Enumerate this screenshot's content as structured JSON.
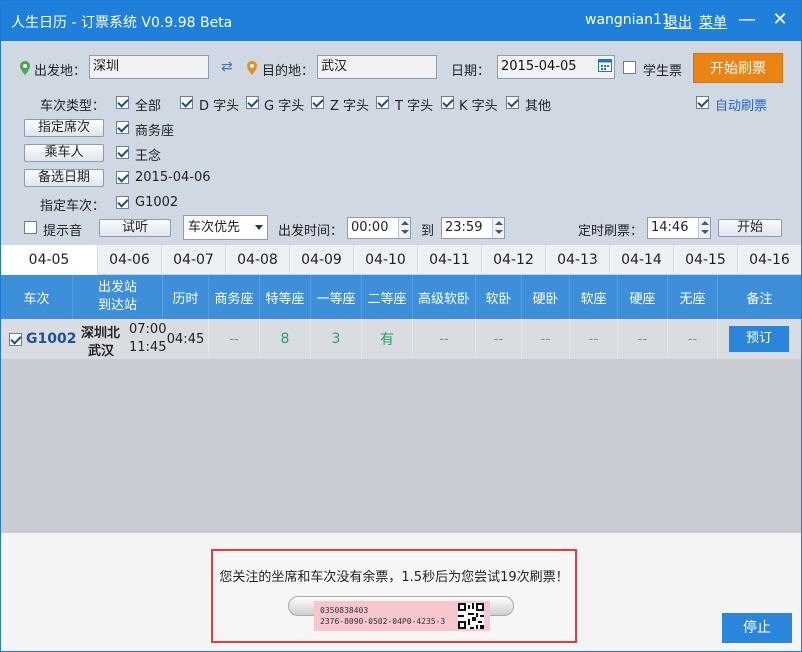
{
  "window": {
    "title": "人生日历 - 订票系统 V0.9.98 Beta",
    "username": "wangnian11",
    "logout_label": "退出",
    "menu_label": "菜单"
  },
  "search": {
    "from_label": "出发地：",
    "from_value": "深圳",
    "to_label": "目的地：",
    "to_value": "武汉",
    "date_label": "日期：",
    "date_value": "2015-04-05",
    "student_label": "学生票",
    "student_checked": false,
    "start_button": "开始刷票",
    "train_type_label": "车次类型：",
    "train_types": [
      {
        "label": "全部",
        "checked": true
      },
      {
        "label": "D 字头",
        "checked": true
      },
      {
        "label": "G 字头",
        "checked": true
      },
      {
        "label": "Z 字头",
        "checked": true
      },
      {
        "label": "T 字头",
        "checked": true
      },
      {
        "label": "K 字头",
        "checked": true
      },
      {
        "label": "其他",
        "checked": true
      }
    ],
    "auto_refresh_label": "自动刷票",
    "auto_refresh_checked": true,
    "seat_button": "指定席次",
    "seat_value": "商务座",
    "passenger_button": "乘车人",
    "passenger_value": "王念",
    "alt_date_button": "备选日期",
    "alt_date_value": "2015-04-06",
    "train_label": "指定车次：",
    "train_value": "G1002",
    "sound_label": "提示音",
    "sound_checked": false,
    "listen_button": "试听",
    "priority_value": "车次优先",
    "depart_time_label": "出发时间：",
    "depart_from": "00:00",
    "to_word": "到",
    "depart_to": "23:59",
    "timer_label": "定时刷票：",
    "timer_value": "14:46",
    "timer_start_button": "开始"
  },
  "date_tabs": [
    "04-05",
    "04-06",
    "04-07",
    "04-08",
    "04-09",
    "04-10",
    "04-11",
    "04-12",
    "04-13",
    "04-14",
    "04-15",
    "04-16"
  ],
  "active_tab": 0,
  "table": {
    "headers": [
      "车次",
      "出发站",
      "到达站",
      "历时",
      "商务座",
      "特等座",
      "一等座",
      "二等座",
      "高级软卧",
      "软卧",
      "硬卧",
      "软座",
      "硬座",
      "无座",
      "备注"
    ],
    "rows": [
      {
        "checked": true,
        "train": "G1002",
        "from_station": "深圳北",
        "to_station": "武汉",
        "depart": "07:00",
        "arrive": "11:45",
        "duration": "04:45",
        "seats": [
          "--",
          "8",
          "3",
          "有",
          "--",
          "--",
          "--",
          "--",
          "--",
          "--"
        ],
        "action": "预订"
      }
    ]
  },
  "notice": {
    "message": "您关注的坐席和车次没有余票，1.5秒后为您尝试19次刷票！",
    "ticket_line1": "0350838403",
    "ticket_line2": "2376-8090-0502-04P0-4235-3"
  },
  "stop_button": "停止",
  "colors": {
    "titlebar": "#1e80da",
    "header": "#3c8fd8",
    "start_button": "#ea8415",
    "notice_border": "#e23c3c",
    "available": "#2a9d6a"
  }
}
